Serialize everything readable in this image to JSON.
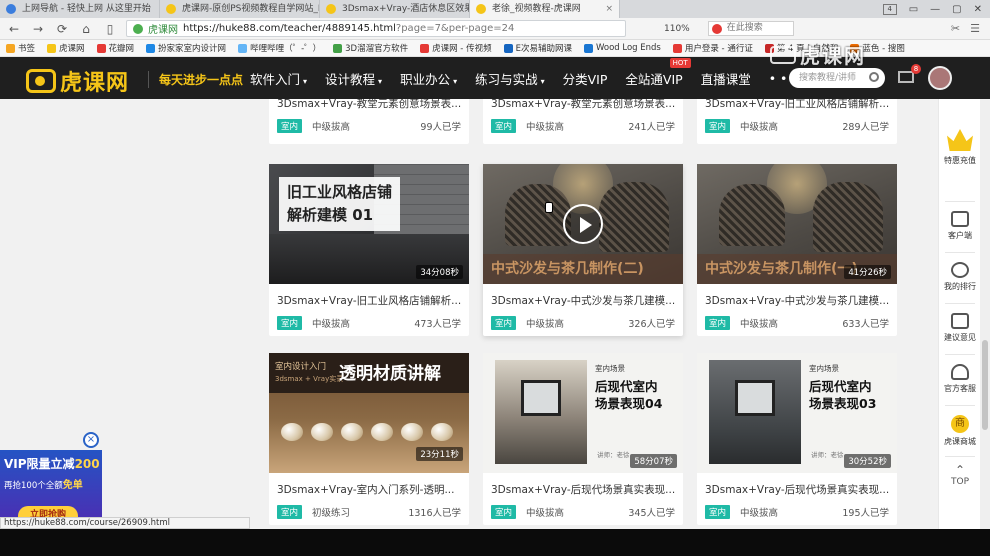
{
  "browser": {
    "tabs": [
      {
        "label": "上网导航 - 轻快上网 从这里开始",
        "color": "#3b7ddd",
        "active": false
      },
      {
        "label": "虎课网-原创PS视频教程自学网站_P...",
        "color": "#f5c518",
        "active": false
      },
      {
        "label": "3Dsmax+Vray-酒店休息区效果表现",
        "color": "#f5c518",
        "active": false
      },
      {
        "label": "老徐_视频教程-虎课网",
        "color": "#f5c518",
        "active": true
      }
    ],
    "tab_close_glyph": "×",
    "window_controls": [
      "4",
      "▭",
      "—",
      "▢",
      "✕"
    ],
    "site_name": "虎课网",
    "url": "https://huke88.com/teacher/4889145.html",
    "url_query": "?page=7&per-page=24",
    "zoom": "110%",
    "search_engine_text": "在此搜索",
    "bookmarks": [
      {
        "label": "书签",
        "color": "#f5a623"
      },
      {
        "label": "虎课网",
        "color": "#f5c518"
      },
      {
        "label": "花瓣网",
        "color": "#e53935"
      },
      {
        "label": "扮家家室内设计网",
        "color": "#1e88e5"
      },
      {
        "label": "哔哩哔哩（゜-゜）",
        "color": "#64b5f6"
      },
      {
        "label": "3D溜溜官方软件",
        "color": "#43a047"
      },
      {
        "label": "虎课网 - 传视频",
        "color": "#e53935"
      },
      {
        "label": "E次易辅助网课",
        "color": "#1565c0"
      },
      {
        "label": "Wood Log Ends",
        "color": "#1976d2"
      },
      {
        "label": "用户登录 - 通行证",
        "color": "#e53935"
      },
      {
        "label": "第 4 頁 | 自然和",
        "color": "#c62828"
      },
      {
        "label": "蓝色 - 搜图",
        "color": "#ef6c00"
      }
    ]
  },
  "site": {
    "logo_text": "虎课网",
    "slogan": "每天进步一点点",
    "nav": [
      {
        "label": "软件入门",
        "caret": true
      },
      {
        "label": "设计教程",
        "caret": true
      },
      {
        "label": "职业办公",
        "caret": true
      },
      {
        "label": "练习与实战",
        "caret": true
      },
      {
        "label": "分类VIP",
        "caret": false
      },
      {
        "label": "全站通VIP",
        "caret": false,
        "badge": "HOT"
      },
      {
        "label": "直播课堂",
        "caret": false
      },
      {
        "label": "• • •",
        "caret": false
      }
    ],
    "search_placeholder": "搜索教程/讲师",
    "mail_count": "8",
    "watermark": "虎课网"
  },
  "cards": [
    {
      "title": "3Dsmax+Vray-教堂元素创意场景表...",
      "tag": "室内",
      "level": "中级拔高",
      "learners": "99人已学"
    },
    {
      "title": "3Dsmax+Vray-教堂元素创意场景表...",
      "tag": "室内",
      "level": "中级拔高",
      "learners": "241人已学"
    },
    {
      "title": "3Dsmax+Vray-旧工业风格店铺解析...",
      "tag": "室内",
      "level": "中级拔高",
      "learners": "289人已学"
    },
    {
      "title": "3Dsmax+Vray-旧工业风格店铺解析...",
      "tag": "室内",
      "level": "中级拔高",
      "learners": "473人已学",
      "thumb_lines": [
        "旧工业风格店铺",
        "解析建模 01"
      ],
      "duration": "34分08秒"
    },
    {
      "title": "3Dsmax+Vray-中式沙发与茶几建模...",
      "tag": "室内",
      "level": "中级拔高",
      "learners": "326人已学",
      "thumb_text": "中式沙发与茶几制作(二)"
    },
    {
      "title": "3Dsmax+Vray-中式沙发与茶几建模...",
      "tag": "室内",
      "level": "中级拔高",
      "learners": "633人已学",
      "thumb_text": "中式沙发与茶几制作(一)",
      "duration": "41分26秒"
    },
    {
      "title": "3Dsmax+Vray-室内入门系列-透明...",
      "tag": "室内",
      "level": "初级练习",
      "learners": "1316人已学",
      "thumb_label": "室内设计入门",
      "thumb_sub": "3dsmax + Vray实录",
      "thumb_big": "透明材质讲解",
      "duration": "23分11秒"
    },
    {
      "title": "3Dsmax+Vray-后现代场景真实表现...",
      "tag": "室内",
      "level": "中级拔高",
      "learners": "345人已学",
      "thumb_small": "室内场景",
      "thumb_lines": [
        "后现代室内",
        "场景表现04"
      ],
      "author": "讲师：老徐",
      "duration": "58分07秒"
    },
    {
      "title": "3Dsmax+Vray-后现代场景真实表现...",
      "tag": "室内",
      "level": "中级拔高",
      "learners": "195人已学",
      "thumb_small": "室内场景",
      "thumb_lines": [
        "后现代室内",
        "场景表现03"
      ],
      "author": "讲师：老徐",
      "duration": "30分52秒"
    }
  ],
  "sidebar": {
    "items": [
      {
        "label": "特惠充值"
      },
      {
        "label": "客户端"
      },
      {
        "label": "我的排行"
      },
      {
        "label": "建议意见"
      },
      {
        "label": "官方客服"
      },
      {
        "label": "虎课商城",
        "glyph": "商"
      },
      {
        "label": "TOP"
      }
    ]
  },
  "vip_ad": {
    "line1_a": "VIP限量立减",
    "line1_b": "200",
    "line2_a": "再抢100个全额",
    "line2_b": "免单",
    "button": "立即抢购"
  },
  "status_url": "https://huke88.com/course/26909.html"
}
